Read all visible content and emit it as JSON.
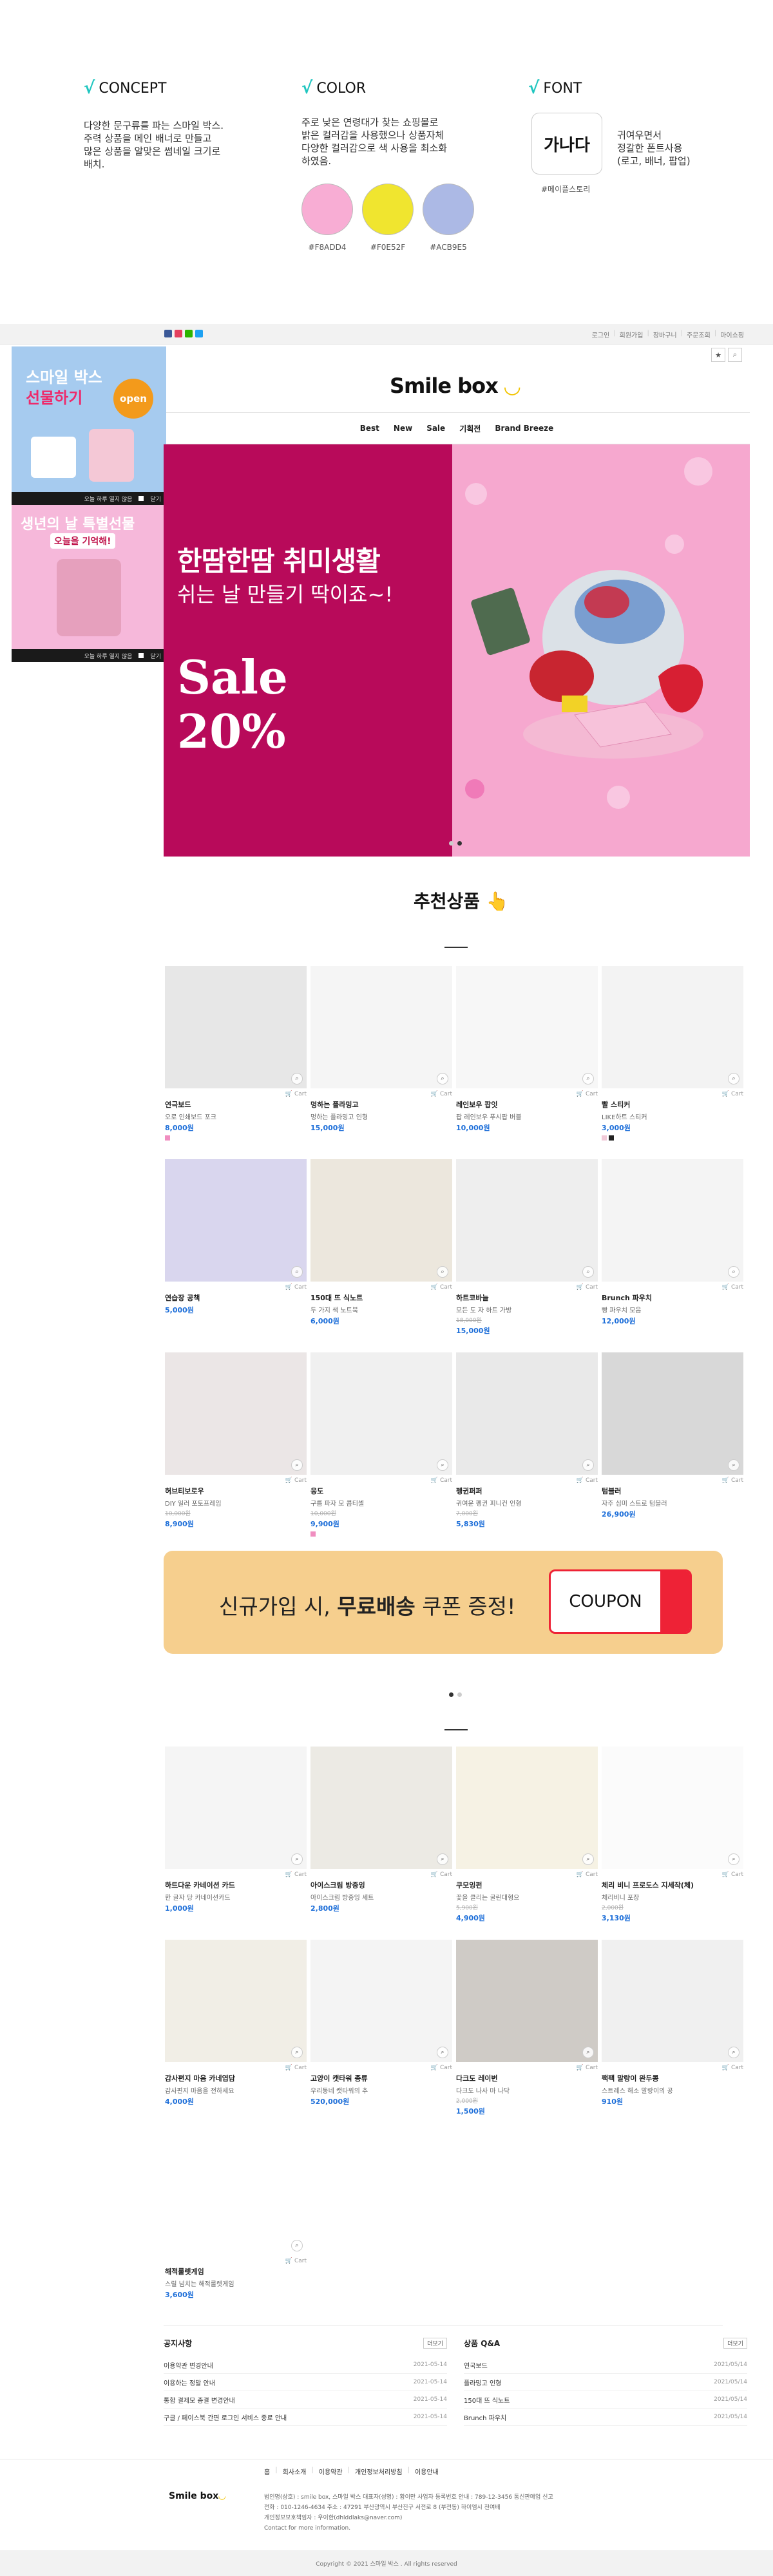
{
  "concept": {
    "concept_title": "CONCEPT",
    "concept_text": [
      "다양한 문구류를 파는 스마일 박스.",
      "주력 상품을 메인 배너로 만들고",
      "많은 상품을 알맞은 썸네일 크기로",
      "배치."
    ],
    "color_title": "COLOR",
    "color_text": [
      "주로 낮은 연령대가 찾는 쇼핑몰로",
      "밝은 컬러감을 사용했으나 상품자체",
      "다양한 컬러감으로 색 사용을 최소화",
      "하였음."
    ],
    "swatches": [
      {
        "hex": "#F8ADD4",
        "label": "#F8ADD4"
      },
      {
        "hex": "#F0E52F",
        "label": "#F0E52F"
      },
      {
        "hex": "#AC89E5",
        "label": "#ACB9E5"
      }
    ],
    "font_title": "FONT",
    "font_sample": "가나다",
    "font_text": [
      "귀여우면서",
      "정갈한 폰트사용",
      "(로고, 배너, 팝업)"
    ],
    "font_name": "#메이플스토리"
  },
  "topbar": {
    "sns_colors": [
      "#3b5998",
      "#e4405f",
      "#2db400",
      "#1da1f2"
    ],
    "links": [
      "로그인",
      "회원가입",
      "장바구니",
      "주문조회",
      "마이쇼핑"
    ]
  },
  "header": {
    "logo_text": "Smile box",
    "logo_mark": "◡",
    "star_icon": "★",
    "search_icon": "⌕",
    "nav": [
      "Best",
      "New",
      "Sale",
      "기획전",
      "Brand Breeze"
    ]
  },
  "side_ads": [
    {
      "title_line1": "스마일 박스",
      "title_line2": "선물하기",
      "badge": "open",
      "footer": "오늘 하루 열지 않음",
      "close": "닫기"
    },
    {
      "title_line1": "생년의 날 특별선물",
      "title_line2": "오늘을 기억해!",
      "footer": "오늘 하루 열지 않음",
      "close": "닫기"
    }
  ],
  "hero": {
    "line1": "한땀한땀 취미생활",
    "line2": "쉬는 날 만들기 딱이죠~!",
    "sale1": "Sale",
    "sale2": "20%"
  },
  "section1": {
    "title": "추천상품",
    "emoji": "👆"
  },
  "products1": [
    {
      "name": "연극보드",
      "desc": "오로 인쇄보드 포크",
      "old": "",
      "price": "8,000원",
      "tag_colors": [
        "#f08ec0"
      ],
      "img": "#e7e7e7"
    },
    {
      "name": "멍하는 플라밍고",
      "desc": "멍하는 플라밍고 인형",
      "old": "",
      "price": "15,000원",
      "tag_colors": [],
      "img": "#f5f5f5"
    },
    {
      "name": "레인보우 팝잇",
      "desc": "팝 레인보우 푸시팝 버블",
      "old": "",
      "price": "10,000원",
      "tag_colors": [],
      "img": "#f7f7f7"
    },
    {
      "name": "빨 스티커",
      "desc": "LIKE하트 스티커",
      "old": "",
      "price": "3,000원",
      "tag_colors": [
        "#f0c9d7",
        "#222222"
      ],
      "img": "#f3f3f3"
    },
    {
      "name": "연습장 공책",
      "desc": "",
      "old": "",
      "price": "5,000원",
      "tag_colors": [],
      "img": "#d9d6ee"
    },
    {
      "name": "150대 뜨 식노트",
      "desc": "두 가지 색 노트북",
      "old": "",
      "price": "6,000원",
      "tag_colors": [],
      "img": "#ece7dd"
    },
    {
      "name": "하트코바늘",
      "desc": "모든 도 자 하트 가방",
      "old": "18,000원",
      "price": "15,000원",
      "tag_colors": [],
      "img": "#eeeeee"
    },
    {
      "name": "Brunch 파우치",
      "desc": "빵 파우치 모음",
      "old": "",
      "price": "12,000원",
      "tag_colors": [],
      "img": "#f4f4f4"
    },
    {
      "name": "허브티보로우",
      "desc": "DIY 일러 포토프레임",
      "old": "10,000원",
      "price": "8,900원",
      "tag_colors": [],
      "img": "#ebe6e6"
    },
    {
      "name": "응도",
      "desc": "구름 파자 모 콤티셀",
      "old": "10,000원",
      "price": "9,900원",
      "tag_colors": [
        "#f08ec0"
      ],
      "img": "#f0f0f0"
    },
    {
      "name": "펭귄퍼퍼",
      "desc": "귀여운 펭귄 피니컨 인형",
      "old": "7,000원",
      "price": "5,830원",
      "tag_colors": [],
      "img": "#e9e9e9"
    },
    {
      "name": "텀블러",
      "desc": "자주 심미 스트로 텀블러",
      "old": "",
      "price": "26,900원",
      "tag_colors": [],
      "img": "#d8d8d8"
    }
  ],
  "coupon": {
    "text_a": "신규가입 시, ",
    "text_b": "무료배송",
    "text_c": " 쿠폰 증정!",
    "button": "COUPON"
  },
  "products2": [
    {
      "name": "하트다운 카네이션 카드",
      "desc": "한 글자 당 카네이션카드",
      "old": "",
      "price": "1,000원",
      "img": "#f5f5f5"
    },
    {
      "name": "아이스크림 방중잉",
      "desc": "아이스크림 방중잉 세트",
      "old": "",
      "price": "2,800원",
      "img": "#eceae4"
    },
    {
      "name": "쿠모잉펀",
      "desc": "꽃을 클리는 굴린대형으",
      "old": "5,900원",
      "price": "4,900원",
      "img": "#f6f2e4"
    },
    {
      "name": "체리 비니 프로도스 지세작(체)",
      "desc": "체리비니 포장",
      "old": "2,000원",
      "price": "3,130원",
      "img": "#fbfbfb"
    },
    {
      "name": "감사편지 마음 카네엽담",
      "desc": "감사편지 마음을 전하세요",
      "old": "",
      "price": "4,000원",
      "img": "#f1eee6"
    },
    {
      "name": "고양이 캣타워 종류",
      "desc": "우리동네 캣타워의 추",
      "old": "",
      "price": "520,000원",
      "img": "#f4f4f4"
    },
    {
      "name": "다크도 레이번",
      "desc": "다크도 나사 마 나닥",
      "old": "2,000원",
      "price": "1,500원",
      "img": "#cfcbc6"
    },
    {
      "name": "팩팩 말랑이 완두콩",
      "desc": "스트레스 해소 말랑이의 공",
      "old": "",
      "price": "910원",
      "img": "#f0f0f0"
    },
    {
      "name": "해적룰렛게임",
      "desc": "스릴 넘치는 해적룰렛게임",
      "old": "",
      "price": "3,600원",
      "img": "#ffffff"
    }
  ],
  "product_meta": "Cart",
  "notice": {
    "title": "공지사항",
    "more": "더보기",
    "rows": [
      {
        "t": "이용약관 변경안내",
        "d": "2021-05-14"
      },
      {
        "t": "이용하는 정말 안내",
        "d": "2021-05-14"
      },
      {
        "t": "통합 결제모 종결 변경안내",
        "d": "2021-05-14"
      },
      {
        "t": "구글 / 페이스북 간편 로그인 서비스 종료 안내",
        "d": "2021-05-14"
      }
    ]
  },
  "qna": {
    "title": "상품 Q&A",
    "more": "더보기",
    "rows": [
      {
        "t": "연국보드",
        "d": "2021/05/14"
      },
      {
        "t": "플라밍고 인형",
        "d": "2021/05/14"
      },
      {
        "t": "150대 뜨 식노트",
        "d": "2021/05/14"
      },
      {
        "t": "Brunch 파우치",
        "d": "2021/05/14"
      }
    ]
  },
  "footer": {
    "links": [
      "홈",
      "회사소개",
      "이용약관",
      "개인정보처리방침",
      "이용안내"
    ],
    "logo": "Smile box",
    "info": [
      "법인명(상호) : smile box, 스마일 박스    대표자(성명) : 황이만    사업자 등록번호 안내 : 789-12-3456    통신판매업 신고",
      "전화 : 010-1246-4634    주소 : 47291 부산광역시 부산진구 서전로 8 (부전동) 하이엠시 천여배",
      "개인정보보호책임자 : 우이한(dhlddlaks@naver.com)",
      "Contact for more information."
    ],
    "copyright": "Copyright © 2021 스마일 박스 . All rights reserved"
  }
}
